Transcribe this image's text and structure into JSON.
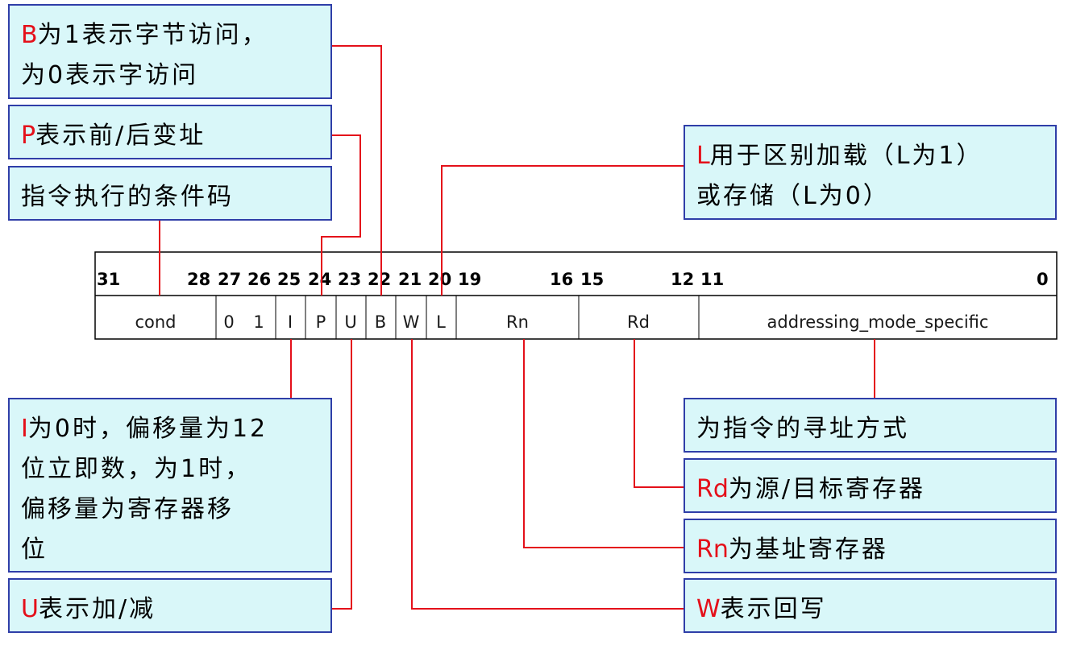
{
  "bit_positions": [
    "31",
    "28",
    "27",
    "26",
    "25",
    "24",
    "23",
    "22",
    "21",
    "20",
    "19",
    "16",
    "15",
    "12",
    "11",
    "0"
  ],
  "fields": [
    "cond",
    "0",
    "1",
    "I",
    "P",
    "U",
    "B",
    "W",
    "L",
    "Rn",
    "Rd",
    "addressing_mode_specific"
  ],
  "notes": {
    "b": {
      "key": "B",
      "lines": [
        "为1表示字节访问，",
        "为0表示字访问"
      ]
    },
    "p": {
      "key": "P",
      "lines": [
        "表示前/后变址"
      ]
    },
    "cond": {
      "key": "",
      "lines": [
        "指令执行的条件码"
      ]
    },
    "l": {
      "key": "L",
      "lines": [
        "用于区别加载（L为1）",
        "或存储（L为0）"
      ]
    },
    "i": {
      "key": "I",
      "lines": [
        "为0时，偏移量为12",
        "位立即数，为1时，",
        "偏移量为寄存器移",
        "位"
      ]
    },
    "u": {
      "key": "U",
      "lines": [
        "表示加/减"
      ]
    },
    "addr": {
      "key": "",
      "lines": [
        "为指令的寻址方式"
      ]
    },
    "rd": {
      "key": "Rd",
      "lines": [
        "为源/目标寄存器"
      ]
    },
    "rn": {
      "key": "Rn",
      "lines": [
        "为基址寄存器"
      ]
    },
    "w": {
      "key": "W",
      "lines": [
        "表示回写"
      ]
    }
  },
  "colors": {
    "note_bg": "#d9f7f9",
    "note_border": "#2f3ea8",
    "connector": "#e4101a",
    "key_letter": "#e4101a"
  }
}
